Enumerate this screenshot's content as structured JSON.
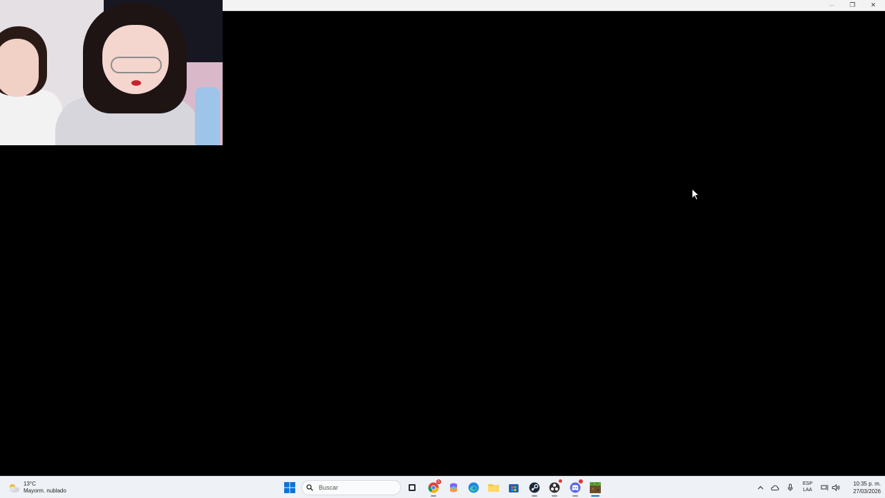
{
  "window": {
    "minimize_glyph": "—",
    "maximize_glyph": "❐",
    "close_glyph": "✕"
  },
  "taskbar": {
    "weather": {
      "temperature": "13°C",
      "condition": "Mayorm. nublado",
      "icon": "cloudy-weather-icon"
    },
    "search": {
      "placeholder": "Buscar"
    },
    "apps": [
      "start-icon",
      "task-view-icon",
      "chrome-icon",
      "copilot-icon",
      "edge-icon",
      "file-explorer-icon",
      "store-icon",
      "steam-icon",
      "obs-icon",
      "discord-icon",
      "minecraft-icon"
    ],
    "chrome_badge": "5",
    "tray": {
      "language_top": "ESP",
      "language_bottom": "LAA",
      "time": "10:35 p. m.",
      "date": "27/03/2026"
    }
  },
  "colors": {
    "taskbar_bg": "#eef1f5",
    "windows_blue": "#0a74da",
    "screen_bg": "#000000"
  }
}
